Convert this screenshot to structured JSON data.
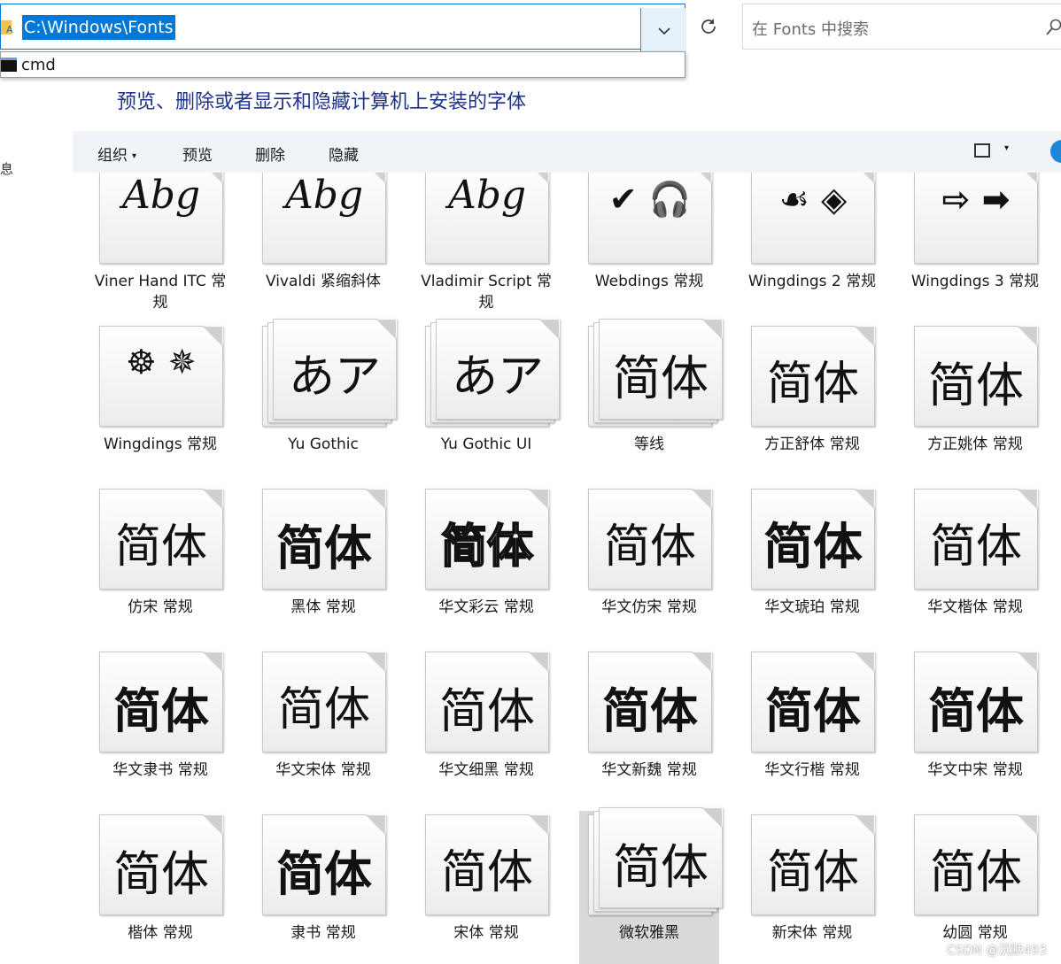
{
  "address_bar": {
    "path": "C:\\Windows\\Fonts"
  },
  "autocomplete": {
    "item": "cmd"
  },
  "search": {
    "placeholder": "在 Fonts 中搜索"
  },
  "headline": "预览、删除或者显示和隐藏计算机上安装的字体",
  "sidebar_fragment": "息",
  "commands": {
    "organize": "组织",
    "preview": "预览",
    "delete": "删除",
    "hide": "隐藏"
  },
  "fonts": [
    {
      "name": "Viner Hand ITC 常规",
      "sample": "Abg",
      "family": "script",
      "stack": false
    },
    {
      "name": "Vivaldi 紧缩斜体",
      "sample": "Abg",
      "family": "script",
      "stack": false
    },
    {
      "name": "Vladimir Script 常规",
      "sample": "Abg",
      "family": "script",
      "stack": false
    },
    {
      "name": "Webdings 常规",
      "sample": "✔ 🎧",
      "family": "symbol",
      "stack": false
    },
    {
      "name": "Wingdings 2 常规",
      "sample": "☙ ◈",
      "family": "symbol",
      "stack": false
    },
    {
      "name": "Wingdings 3 常规",
      "sample": "⇨ ➡",
      "family": "symbol",
      "stack": false
    },
    {
      "name": "Wingdings 常规",
      "sample": "☸ ✵",
      "family": "symbol",
      "stack": false
    },
    {
      "name": "Yu Gothic",
      "sample": "あア",
      "family": "cjk-light",
      "stack": true
    },
    {
      "name": "Yu Gothic UI",
      "sample": "あア",
      "family": "cjk-light",
      "stack": true
    },
    {
      "name": "等线",
      "sample": "简体",
      "family": "cjk",
      "stack": true
    },
    {
      "name": "方正舒体 常规",
      "sample": "简体",
      "family": "cjk-light",
      "stack": false
    },
    {
      "name": "方正姚体 常规",
      "sample": "简体",
      "family": "cjk",
      "stack": false
    },
    {
      "name": "仿宋 常规",
      "sample": "简体",
      "family": "cjk-light",
      "stack": false
    },
    {
      "name": "黑体 常规",
      "sample": "简体",
      "family": "cjk-bold",
      "stack": false
    },
    {
      "name": "华文彩云 常规",
      "sample": "简体",
      "family": "cjk-outline",
      "stack": false
    },
    {
      "name": "华文仿宋 常规",
      "sample": "简体",
      "family": "cjk-light",
      "stack": false
    },
    {
      "name": "华文琥珀 常规",
      "sample": "简体",
      "family": "cjk-heavy",
      "stack": false
    },
    {
      "name": "华文楷体 常规",
      "sample": "简体",
      "family": "cjk-light",
      "stack": false
    },
    {
      "name": "华文隶书 常规",
      "sample": "简体",
      "family": "cjk-bold",
      "stack": false
    },
    {
      "name": "华文宋体 常规",
      "sample": "简体",
      "family": "cjk-light",
      "stack": false
    },
    {
      "name": "华文细黑 常规",
      "sample": "简体",
      "family": "cjk",
      "stack": false
    },
    {
      "name": "华文新魏 常规",
      "sample": "简体",
      "family": "cjk-bold",
      "stack": false
    },
    {
      "name": "华文行楷 常规",
      "sample": "简体",
      "family": "cjk-bold",
      "stack": false
    },
    {
      "name": "华文中宋 常规",
      "sample": "简体",
      "family": "cjk-bold",
      "stack": false
    },
    {
      "name": "楷体 常规",
      "sample": "简体",
      "family": "cjk",
      "stack": false
    },
    {
      "name": "隶书 常规",
      "sample": "简体",
      "family": "cjk-bold",
      "stack": false
    },
    {
      "name": "宋体 常规",
      "sample": "简体",
      "family": "cjk-light",
      "stack": false
    },
    {
      "name": "微软雅黑",
      "sample": "简体",
      "family": "cjk",
      "stack": true,
      "selected": true
    },
    {
      "name": "新宋体 常规",
      "sample": "简体",
      "family": "cjk-light",
      "stack": false
    },
    {
      "name": "幼圆 常规",
      "sample": "简体",
      "family": "cjk-light",
      "stack": false
    }
  ],
  "watermark": "CSDN @沉默493"
}
